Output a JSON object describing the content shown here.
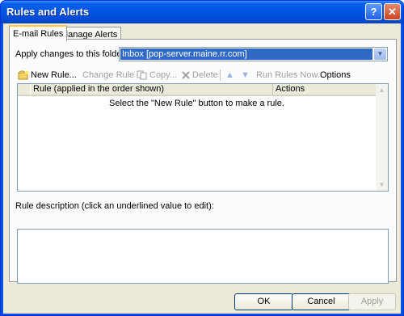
{
  "window": {
    "title": "Rules and Alerts"
  },
  "tabs": [
    {
      "label": "E-mail Rules"
    },
    {
      "label": "Manage Alerts"
    }
  ],
  "folder": {
    "label": "Apply changes to this folder:",
    "value": "Inbox [pop-server.maine.rr.com]"
  },
  "toolbar": {
    "new_rule": "New Rule...",
    "change_rule": "Change Rule",
    "copy": "Copy...",
    "delete": "Delete",
    "run_rules": "Run Rules Now...",
    "options": "Options"
  },
  "rules_table": {
    "columns": [
      "Rule (applied in the order shown)",
      "Actions"
    ],
    "empty_message": "Select the \"New Rule\" button to make a rule."
  },
  "description": {
    "label": "Rule description (click an underlined value to edit):"
  },
  "buttons": {
    "ok": "OK",
    "cancel": "Cancel",
    "apply": "Apply"
  },
  "colors": {
    "titlebar": "#0054e3",
    "dialog_bg": "#ece9d8",
    "selection": "#316ac5",
    "active_tab_accent": "#ffc83c"
  }
}
